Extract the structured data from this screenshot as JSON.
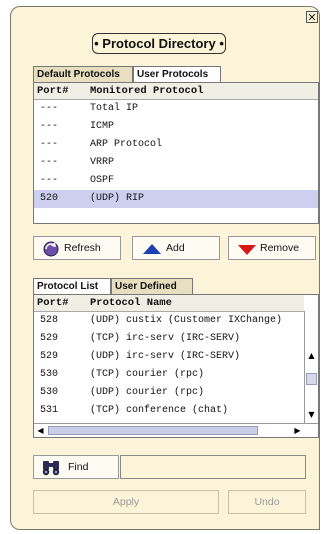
{
  "dialog": {
    "title": "Protocol Directory",
    "close_icon": "close-icon"
  },
  "top_tabs": [
    {
      "label": "Default Protocols"
    },
    {
      "label": "User Protocols"
    }
  ],
  "monitored": {
    "headers": [
      "Port#",
      "Monitored Protocol"
    ],
    "rows": [
      {
        "port": "---",
        "protocol": "Total IP"
      },
      {
        "port": "---",
        "protocol": "ICMP"
      },
      {
        "port": "---",
        "protocol": "ARP Protocol"
      },
      {
        "port": "---",
        "protocol": "VRRP"
      },
      {
        "port": "---",
        "protocol": "OSPF"
      },
      {
        "port": "520",
        "protocol": "(UDP) RIP"
      }
    ]
  },
  "actions": {
    "refresh": "Refresh",
    "add": "Add",
    "remove": "Remove"
  },
  "bottom_tabs": [
    {
      "label": "Protocol List"
    },
    {
      "label": "User Defined"
    }
  ],
  "protocol_list": {
    "headers": [
      "Port#",
      "Protocol Name"
    ],
    "rows": [
      {
        "port": "528",
        "name": "(UDP) custix (Customer IXChange)"
      },
      {
        "port": "529",
        "name": "(TCP) irc-serv (IRC-SERV)"
      },
      {
        "port": "529",
        "name": "(UDP) irc-serv (IRC-SERV)"
      },
      {
        "port": "530",
        "name": "(TCP) courier (rpc)"
      },
      {
        "port": "530",
        "name": "(UDP) courier (rpc)"
      },
      {
        "port": "531",
        "name": "(TCP) conference (chat)"
      }
    ]
  },
  "find": {
    "label": "Find",
    "value": ""
  },
  "footer": {
    "apply": "Apply",
    "undo": "Undo"
  },
  "colors": {
    "panel": "#fbf4d8",
    "selected_row": "#ccd0ee",
    "add_arrow": "#1a3fb0",
    "remove_arrow": "#d81818"
  }
}
